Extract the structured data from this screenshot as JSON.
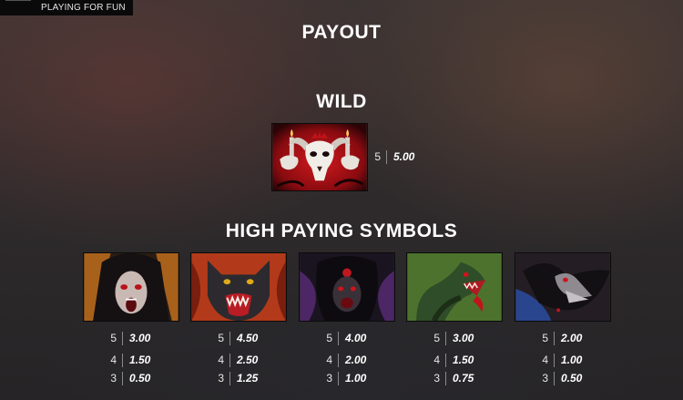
{
  "mode_label": "PLAYING FOR FUN",
  "titles": {
    "payout": "PAYOUT",
    "wild": "WILD",
    "high": "HIGH PAYING SYMBOLS"
  },
  "wild": {
    "icon": "goat-skull-candles-icon",
    "pays": [
      {
        "count": "5",
        "value": "5.00"
      }
    ]
  },
  "high_symbols": [
    {
      "icon": "screaming-woman-icon",
      "pays": [
        {
          "count": "5",
          "value": "3.00"
        },
        {
          "count": "4",
          "value": "1.50"
        },
        {
          "count": "3",
          "value": "0.50"
        }
      ]
    },
    {
      "icon": "snarling-wolf-icon",
      "pays": [
        {
          "count": "5",
          "value": "4.50"
        },
        {
          "count": "4",
          "value": "2.50"
        },
        {
          "count": "3",
          "value": "1.25"
        }
      ]
    },
    {
      "icon": "hooded-demon-icon",
      "pays": [
        {
          "count": "5",
          "value": "4.00"
        },
        {
          "count": "4",
          "value": "2.00"
        },
        {
          "count": "3",
          "value": "1.00"
        }
      ]
    },
    {
      "icon": "green-serpent-icon",
      "pays": [
        {
          "count": "5",
          "value": "3.00"
        },
        {
          "count": "4",
          "value": "1.50"
        },
        {
          "count": "3",
          "value": "0.75"
        }
      ]
    },
    {
      "icon": "raven-skull-icon",
      "pays": [
        {
          "count": "5",
          "value": "2.00"
        },
        {
          "count": "4",
          "value": "1.00"
        },
        {
          "count": "3",
          "value": "0.50"
        }
      ]
    }
  ],
  "colors": {
    "accent_red": "#c0141a",
    "text": "#ffffff"
  }
}
